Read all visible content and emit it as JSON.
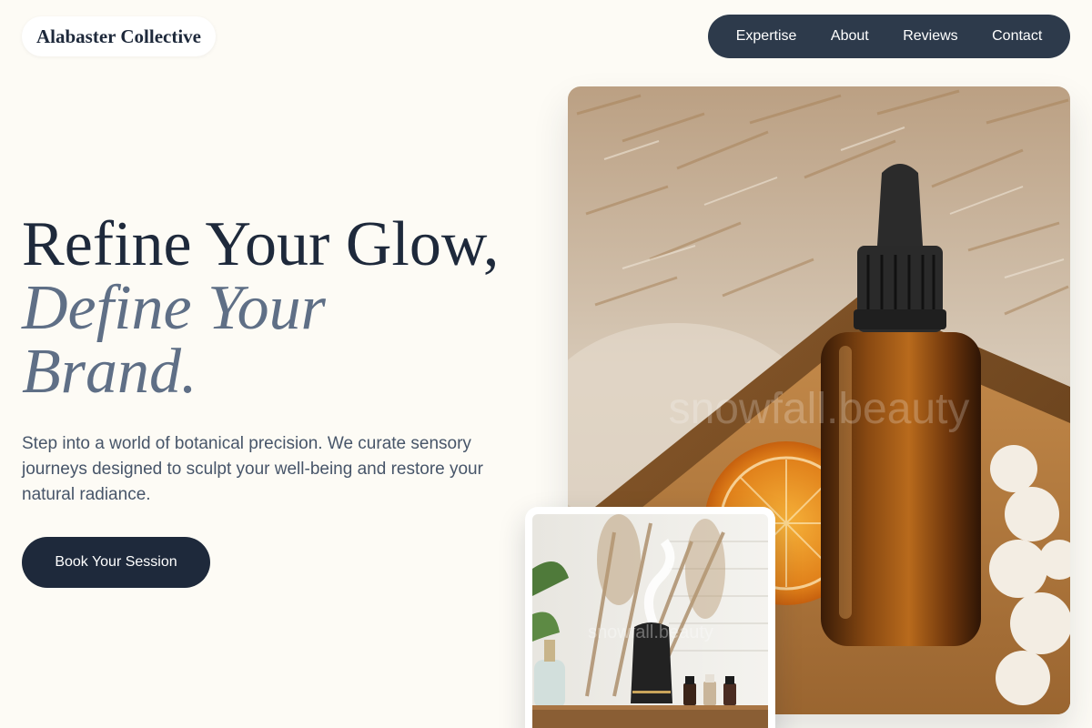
{
  "brand": {
    "name": "Alabaster Collective"
  },
  "nav": {
    "items": [
      {
        "label": "Expertise"
      },
      {
        "label": "About"
      },
      {
        "label": "Reviews"
      },
      {
        "label": "Contact"
      }
    ]
  },
  "hero": {
    "headline_line1": "Refine Your Glow,",
    "headline_line2": "Define Your",
    "headline_line3": "Brand.",
    "description": "Step into a world of botanical precision. We curate sensory journeys designed to sculpt your well-being and restore your natural radiance.",
    "cta_label": "Book Your Session"
  },
  "images": {
    "main": {
      "subject": "amber-dropper-bottle-with-dried-orange-and-pampas",
      "watermark": "snowfall.beauty"
    },
    "thumbnail": {
      "subject": "black-aroma-diffuser-with-essential-oil-bottles",
      "watermark": "snowfall.beauty"
    }
  },
  "colors": {
    "background": "#fdfbf5",
    "nav_background": "#2d3a4b",
    "primary_dark": "#1e293b",
    "accent_slate": "#5f6f86",
    "body_text": "#475569"
  }
}
